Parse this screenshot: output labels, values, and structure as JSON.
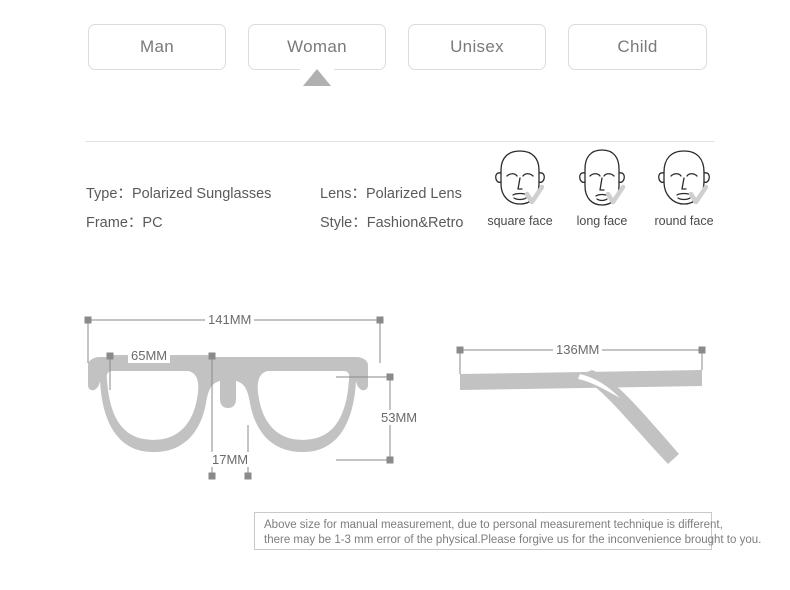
{
  "tabs": {
    "items": [
      {
        "label": "Man",
        "selected": false
      },
      {
        "label": "Woman",
        "selected": true
      },
      {
        "label": "Unisex",
        "selected": false
      },
      {
        "label": "Child",
        "selected": false
      }
    ]
  },
  "specs": {
    "rows": [
      [
        {
          "key": "Type：",
          "value": "Polarized Sunglasses"
        },
        {
          "key": "Lens：",
          "value": "Polarized Lens"
        }
      ],
      [
        {
          "key": "Frame：",
          "value": "PC"
        },
        {
          "key": "Style：",
          "value": "Fashion&Retro"
        }
      ]
    ]
  },
  "face_shapes": {
    "items": [
      {
        "label": "square face",
        "icon": "square-face-icon",
        "check": true
      },
      {
        "label": "long face",
        "icon": "long-face-icon",
        "check": true
      },
      {
        "label": "round face",
        "icon": "round-face-icon",
        "check": true
      }
    ]
  },
  "measurements": {
    "front": {
      "total_width": "141MM",
      "lens_width": "65MM",
      "bridge_width": "17MM",
      "lens_height": "53MM"
    },
    "side": {
      "temple_length": "136MM"
    }
  },
  "note": {
    "line1": "Above size for manual measurement, due to personal measurement technique is different,",
    "line2": "there may be 1-3 mm error of the physical.Please forgive us for the inconvenience brought to you."
  },
  "colors": {
    "background": "#ffffff",
    "frame_gray": "#c2c2c2",
    "dimension_line": "#8a8a8a",
    "tab_border": "#dcdcdc",
    "caret": "#b0b0b0",
    "text": "#6e6e6e",
    "note_border": "#c9c9c9"
  }
}
